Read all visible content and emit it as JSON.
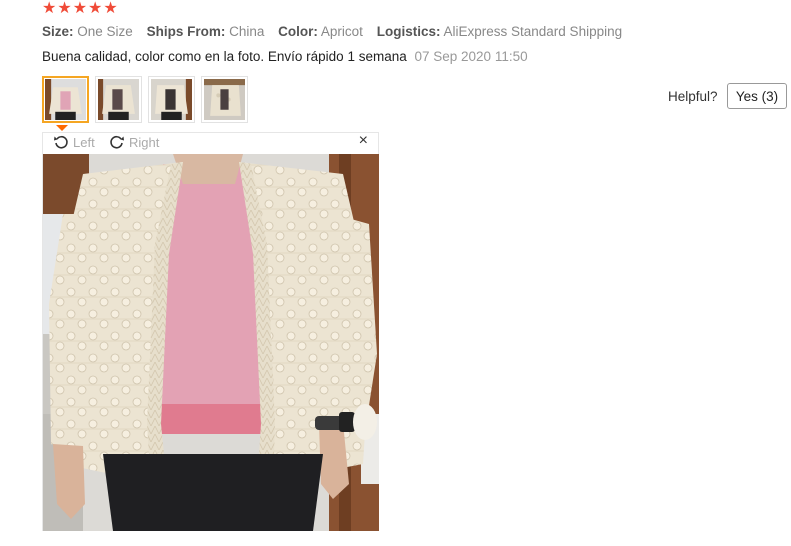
{
  "rating": {
    "stars": 5,
    "max": 5,
    "color": "#f04b38"
  },
  "meta": [
    {
      "label": "Size:",
      "value": "One Size"
    },
    {
      "label": "Ships From:",
      "value": "China"
    },
    {
      "label": "Color:",
      "value": "Apricot"
    },
    {
      "label": "Logistics:",
      "value": "AliExpress Standard Shipping"
    }
  ],
  "review": {
    "text": "Buena calidad, color como en la foto. Envío rápido 1 semana",
    "date": "07 Sep 2020 11:50"
  },
  "thumbnails": {
    "count": 4,
    "active_index": 0
  },
  "helpful": {
    "label": "Helpful?",
    "button": "Yes (3)"
  },
  "viewer": {
    "rotate_left": "Left",
    "rotate_right": "Right",
    "close": "×"
  },
  "colors": {
    "accent": "#ff6a00",
    "thumb_active_border": "#f5a623"
  },
  "icons": [
    "star-icon",
    "rotate-left-icon",
    "rotate-right-icon",
    "close-icon"
  ]
}
